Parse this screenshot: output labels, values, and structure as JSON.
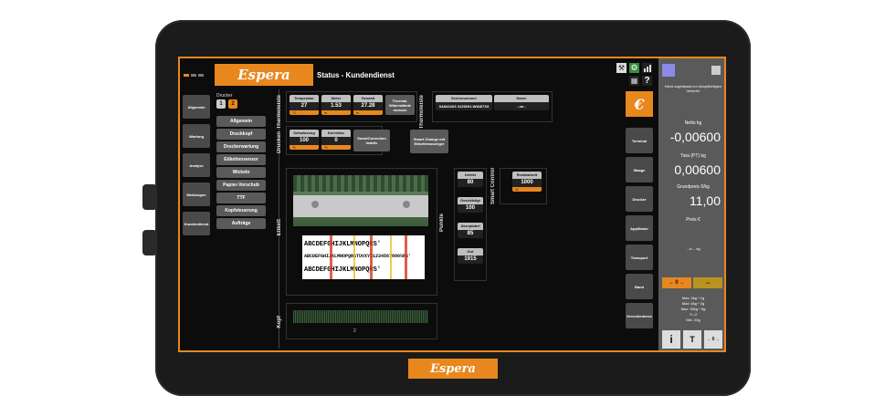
{
  "brand": {
    "logo_text": "Espera",
    "accent": "#e8871e"
  },
  "header": {
    "title": "Status - Kundendienst"
  },
  "left_nav": [
    {
      "label": "Allgemein"
    },
    {
      "label": "Wartung"
    },
    {
      "label": "Analyse"
    },
    {
      "label": "Meldungen"
    },
    {
      "label": "Kundendienst",
      "active": true
    }
  ],
  "printer_selector": {
    "label": "Drucker",
    "options": [
      "1",
      "2"
    ],
    "selected": "2"
  },
  "sub_menu": [
    {
      "label": "Allgemein"
    },
    {
      "label": "Druckkopf",
      "active": true
    },
    {
      "label": "Druckerwartung"
    },
    {
      "label": "Etikettensensor"
    },
    {
      "label": "Wickeln"
    },
    {
      "label": "Papier-Vorschub"
    },
    {
      "label": "TTF"
    },
    {
      "label": "Kopfsteuerung"
    },
    {
      "label": "Aufträge"
    }
  ],
  "section_labels": {
    "thermoleiste_left": "Thermoleiste",
    "drucken": "Drucken",
    "thermoleiste_right": "Thermoleiste",
    "etikett": "Etikett",
    "punkte": "Punkte",
    "smart_control": "Smart Control",
    "kopf": "Kopf"
  },
  "thermoleiste": [
    {
      "header": "Temperatur",
      "value": "27",
      "unit": "°C"
    },
    {
      "header": "Meter",
      "value": "1.53",
      "unit": "m"
    },
    {
      "header": "Gesamt",
      "value": "27.28",
      "unit": "m"
    }
  ],
  "thermal_resistance_button": "Thermal. Widerstände messen",
  "series_table": {
    "headers": [
      "Seriennummer",
      "Name"
    ],
    "values": [
      "0A8424X3 3129201-W8467X3",
      "- no -"
    ]
  },
  "drucken": [
    {
      "header": "Schwärzung",
      "value": "100",
      "unit": "%"
    },
    {
      "header": "Korrektur",
      "value": "0",
      "unit": "%"
    }
  ],
  "smartcorrection_button": "SmartCorrection Inaktiv",
  "smart_change_button": "Smart Change mit Etikettenanzeiger",
  "punkte": [
    {
      "label": "Defekt",
      "value": "80"
    },
    {
      "label": "Geschädigt",
      "value": "100"
    },
    {
      "label": "Akzeptabel",
      "value": "85"
    },
    {
      "label": "Gut",
      "value": "1915"
    }
  ],
  "smart_control": {
    "header": "Restlaufzeit",
    "value": "1000",
    "unit": "%"
  },
  "label_text_lines": [
    "ABCDEFGHIJKLMNOPQRS'",
    "ABCDEFGHIJKLMNOPQRSTUVXYZ1234567890%RS'",
    "ABCDEFGHIJKLMNOPQRS'"
  ],
  "kopf_value": "2",
  "right_tabs": [
    {
      "label": "Terminal"
    },
    {
      "label": "Waage"
    },
    {
      "label": "Drucker",
      "active": true
    },
    {
      "label": "Applikator"
    },
    {
      "label": "Transport"
    },
    {
      "label": "Band"
    },
    {
      "label": "Verschiedenes"
    }
  ],
  "right_panel": {
    "notice": "Nicht zugelassen im eichpflichtigen Verkehr!",
    "netto_label": "Netto kg",
    "netto_value": "-0,00600",
    "tara_label": "Tara (PT) kg",
    "tara_value": "0,00600",
    "grundpreis_label": "Grundpreis €/kg",
    "grundpreis_value": "11,00",
    "preis_label": "Preis €",
    "scale_symbol": "→e← kg",
    "zero_btn": "→ 0 ←",
    "tilde_btn": "~",
    "specs": [
      "Max: 3kg * 1g",
      "Max: 6kg * 2g",
      "Max: 30kg * 5g",
      "T=-2",
      "Min: 20g"
    ],
    "info_btn": "i",
    "tare_btn": "T",
    "zero_btn2": "→ 0 ←"
  },
  "top_icons": [
    "wrench-icon",
    "gear-icon",
    "chart-icon",
    "network-icon",
    "help-icon"
  ]
}
